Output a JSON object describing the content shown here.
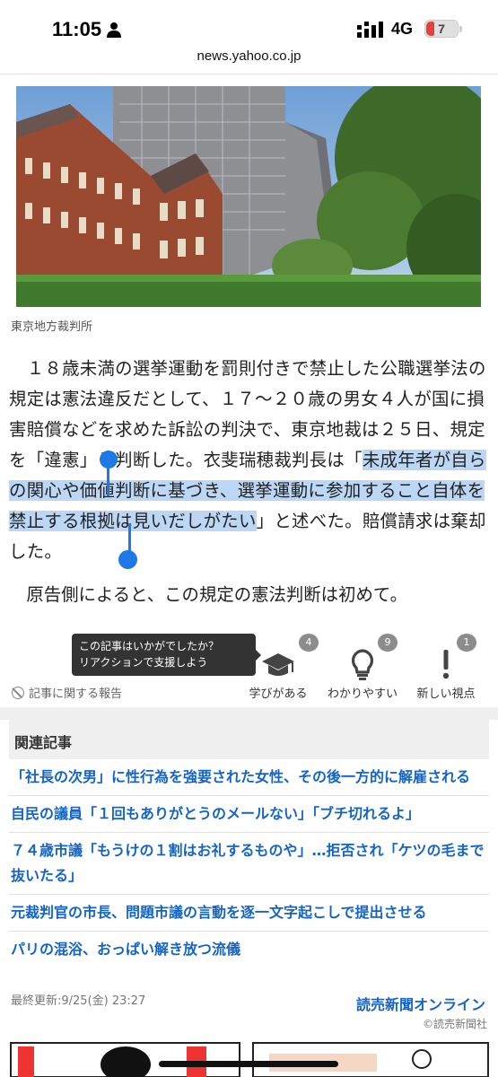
{
  "status_bar": {
    "time": "11:05",
    "network": "4G",
    "battery": "7"
  },
  "browser": {
    "url": "news.yahoo.co.jp"
  },
  "photo": {
    "caption": "東京地方裁判所"
  },
  "article": {
    "p1_before": "　１８歳未満の選挙運動を罰則付きで禁止した公職選挙法の規定は憲法違反だとして、１７～２０歳の男女４人が国に損害賠償などを求めた訴訟の判決で、東京地裁は２５日、規定を「違憲」と判断した。衣斐瑞穂裁判長は「",
    "p1_highlight": "未成年者が自らの関心や価値判断に基づき、選挙運動に参加すること自体を禁止する根拠は見いだしがたい",
    "p1_after": "」と述べた。賠償請求は棄却した。",
    "p2": "　原告側によると、この規定の憲法判断は初めて。"
  },
  "reactions": {
    "tooltip_line1": "この記事はいかがでしたか？",
    "tooltip_line2": "リアクションで支援しよう",
    "report_label": "記事に関する報告",
    "items": [
      {
        "label": "学びがある",
        "count": "4",
        "icon": "graduation-cap-icon"
      },
      {
        "label": "わかりやすい",
        "count": "9",
        "icon": "lightbulb-icon"
      },
      {
        "label": "新しい視点",
        "count": "1",
        "icon": "exclamation-icon"
      }
    ]
  },
  "related": {
    "heading": "関連記事",
    "items": [
      "「社長の次男」に性行為を強要された女性、その後一方的に解雇される",
      "自民の議員「１回もありがとうのメールない」「ブチ切れるよ」",
      "７４歳市議「もうけの１割はお礼するものや」…拒否され「ケツの毛まで抜いたる」",
      "元裁判官の市長、問題市議の言動を逐一文字起こしで提出させる",
      "パリの混浴、おっぱい解き放つ流儀"
    ]
  },
  "footer": {
    "updated": "最終更新:9/25(金) 23:27",
    "source": "読売新聞オンライン",
    "copyright": "©読売新聞社"
  },
  "colors": {
    "link": "#1464c8",
    "highlight": "#bcd7f5",
    "selection_handle": "#1e78e6"
  }
}
